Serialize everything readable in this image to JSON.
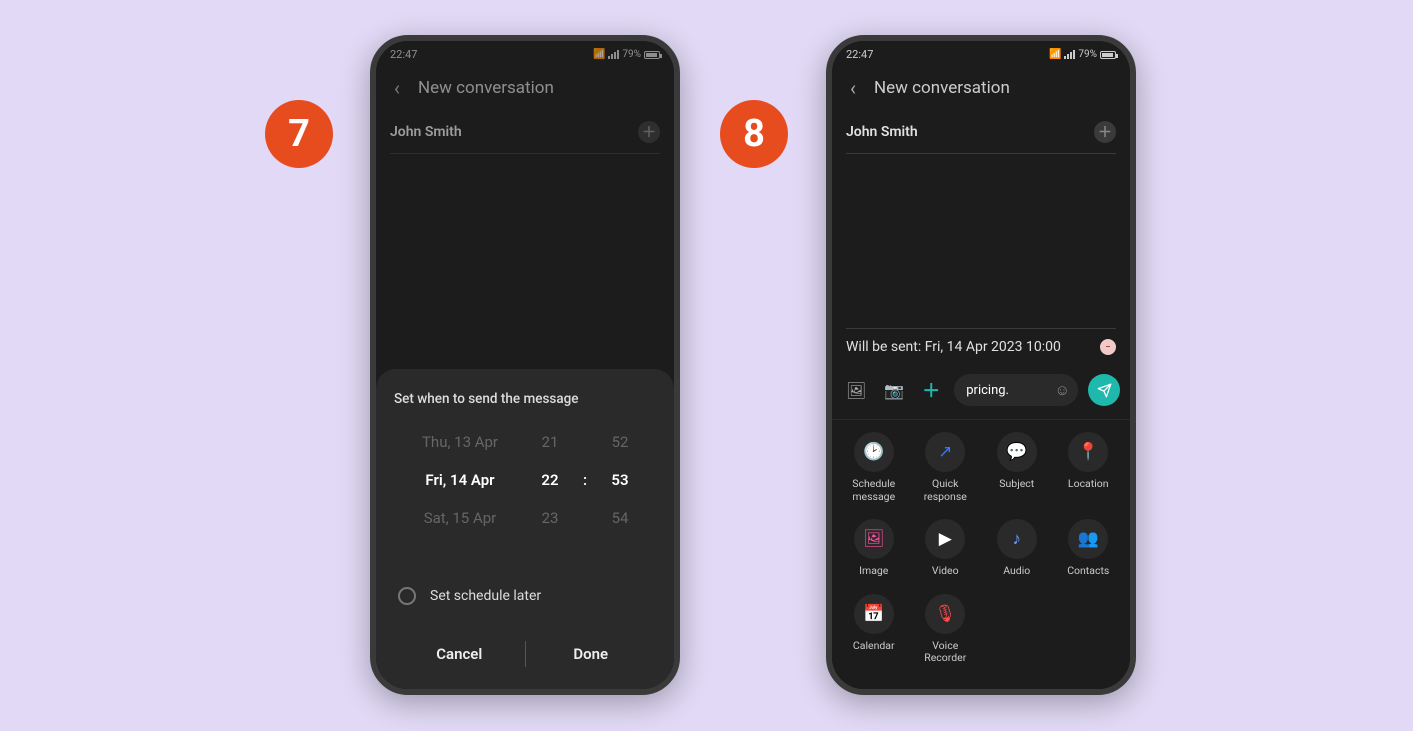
{
  "steps": {
    "7": "7",
    "8": "8"
  },
  "status": {
    "time": "22:47",
    "battery": "79%"
  },
  "header": {
    "title": "New conversation"
  },
  "recipient": {
    "name": "John Smith"
  },
  "schedule_sheet": {
    "title": "Set when to send the message",
    "dates": {
      "prev": "Thu, 13 Apr",
      "sel": "Fri, 14 Apr",
      "next": "Sat, 15 Apr"
    },
    "hours": {
      "prev": "21",
      "sel": "22",
      "next": "23"
    },
    "mins": {
      "prev": "52",
      "sel": "53",
      "next": "54"
    },
    "sep": ":",
    "later_label": "Set schedule later",
    "cancel": "Cancel",
    "done": "Done"
  },
  "phone8": {
    "scheduled": "Will be sent: Fri, 14 Apr 2023 10:00",
    "input": "pricing.",
    "attach": [
      {
        "label": "Schedule message",
        "color": "#2e7bff",
        "glyph": "🕑"
      },
      {
        "label": "Quick response",
        "color": "#2e7bff",
        "glyph": "↗"
      },
      {
        "label": "Subject",
        "color": "#2e7bff",
        "glyph": "💬"
      },
      {
        "label": "Location",
        "color": "#6dd94a",
        "glyph": "📍"
      },
      {
        "label": "Image",
        "color": "#ff4da0",
        "glyph": "🖼"
      },
      {
        "label": "Video",
        "color": "#ffffff",
        "glyph": "▶"
      },
      {
        "label": "Audio",
        "color": "#6aa0ff",
        "glyph": "♪"
      },
      {
        "label": "Contacts",
        "color": "#ff8a4a",
        "glyph": "👥"
      },
      {
        "label": "Calendar",
        "color": "#4aff9a",
        "glyph": "📅"
      },
      {
        "label": "Voice Recorder",
        "color": "#ff4d4d",
        "glyph": "🎙"
      }
    ]
  }
}
